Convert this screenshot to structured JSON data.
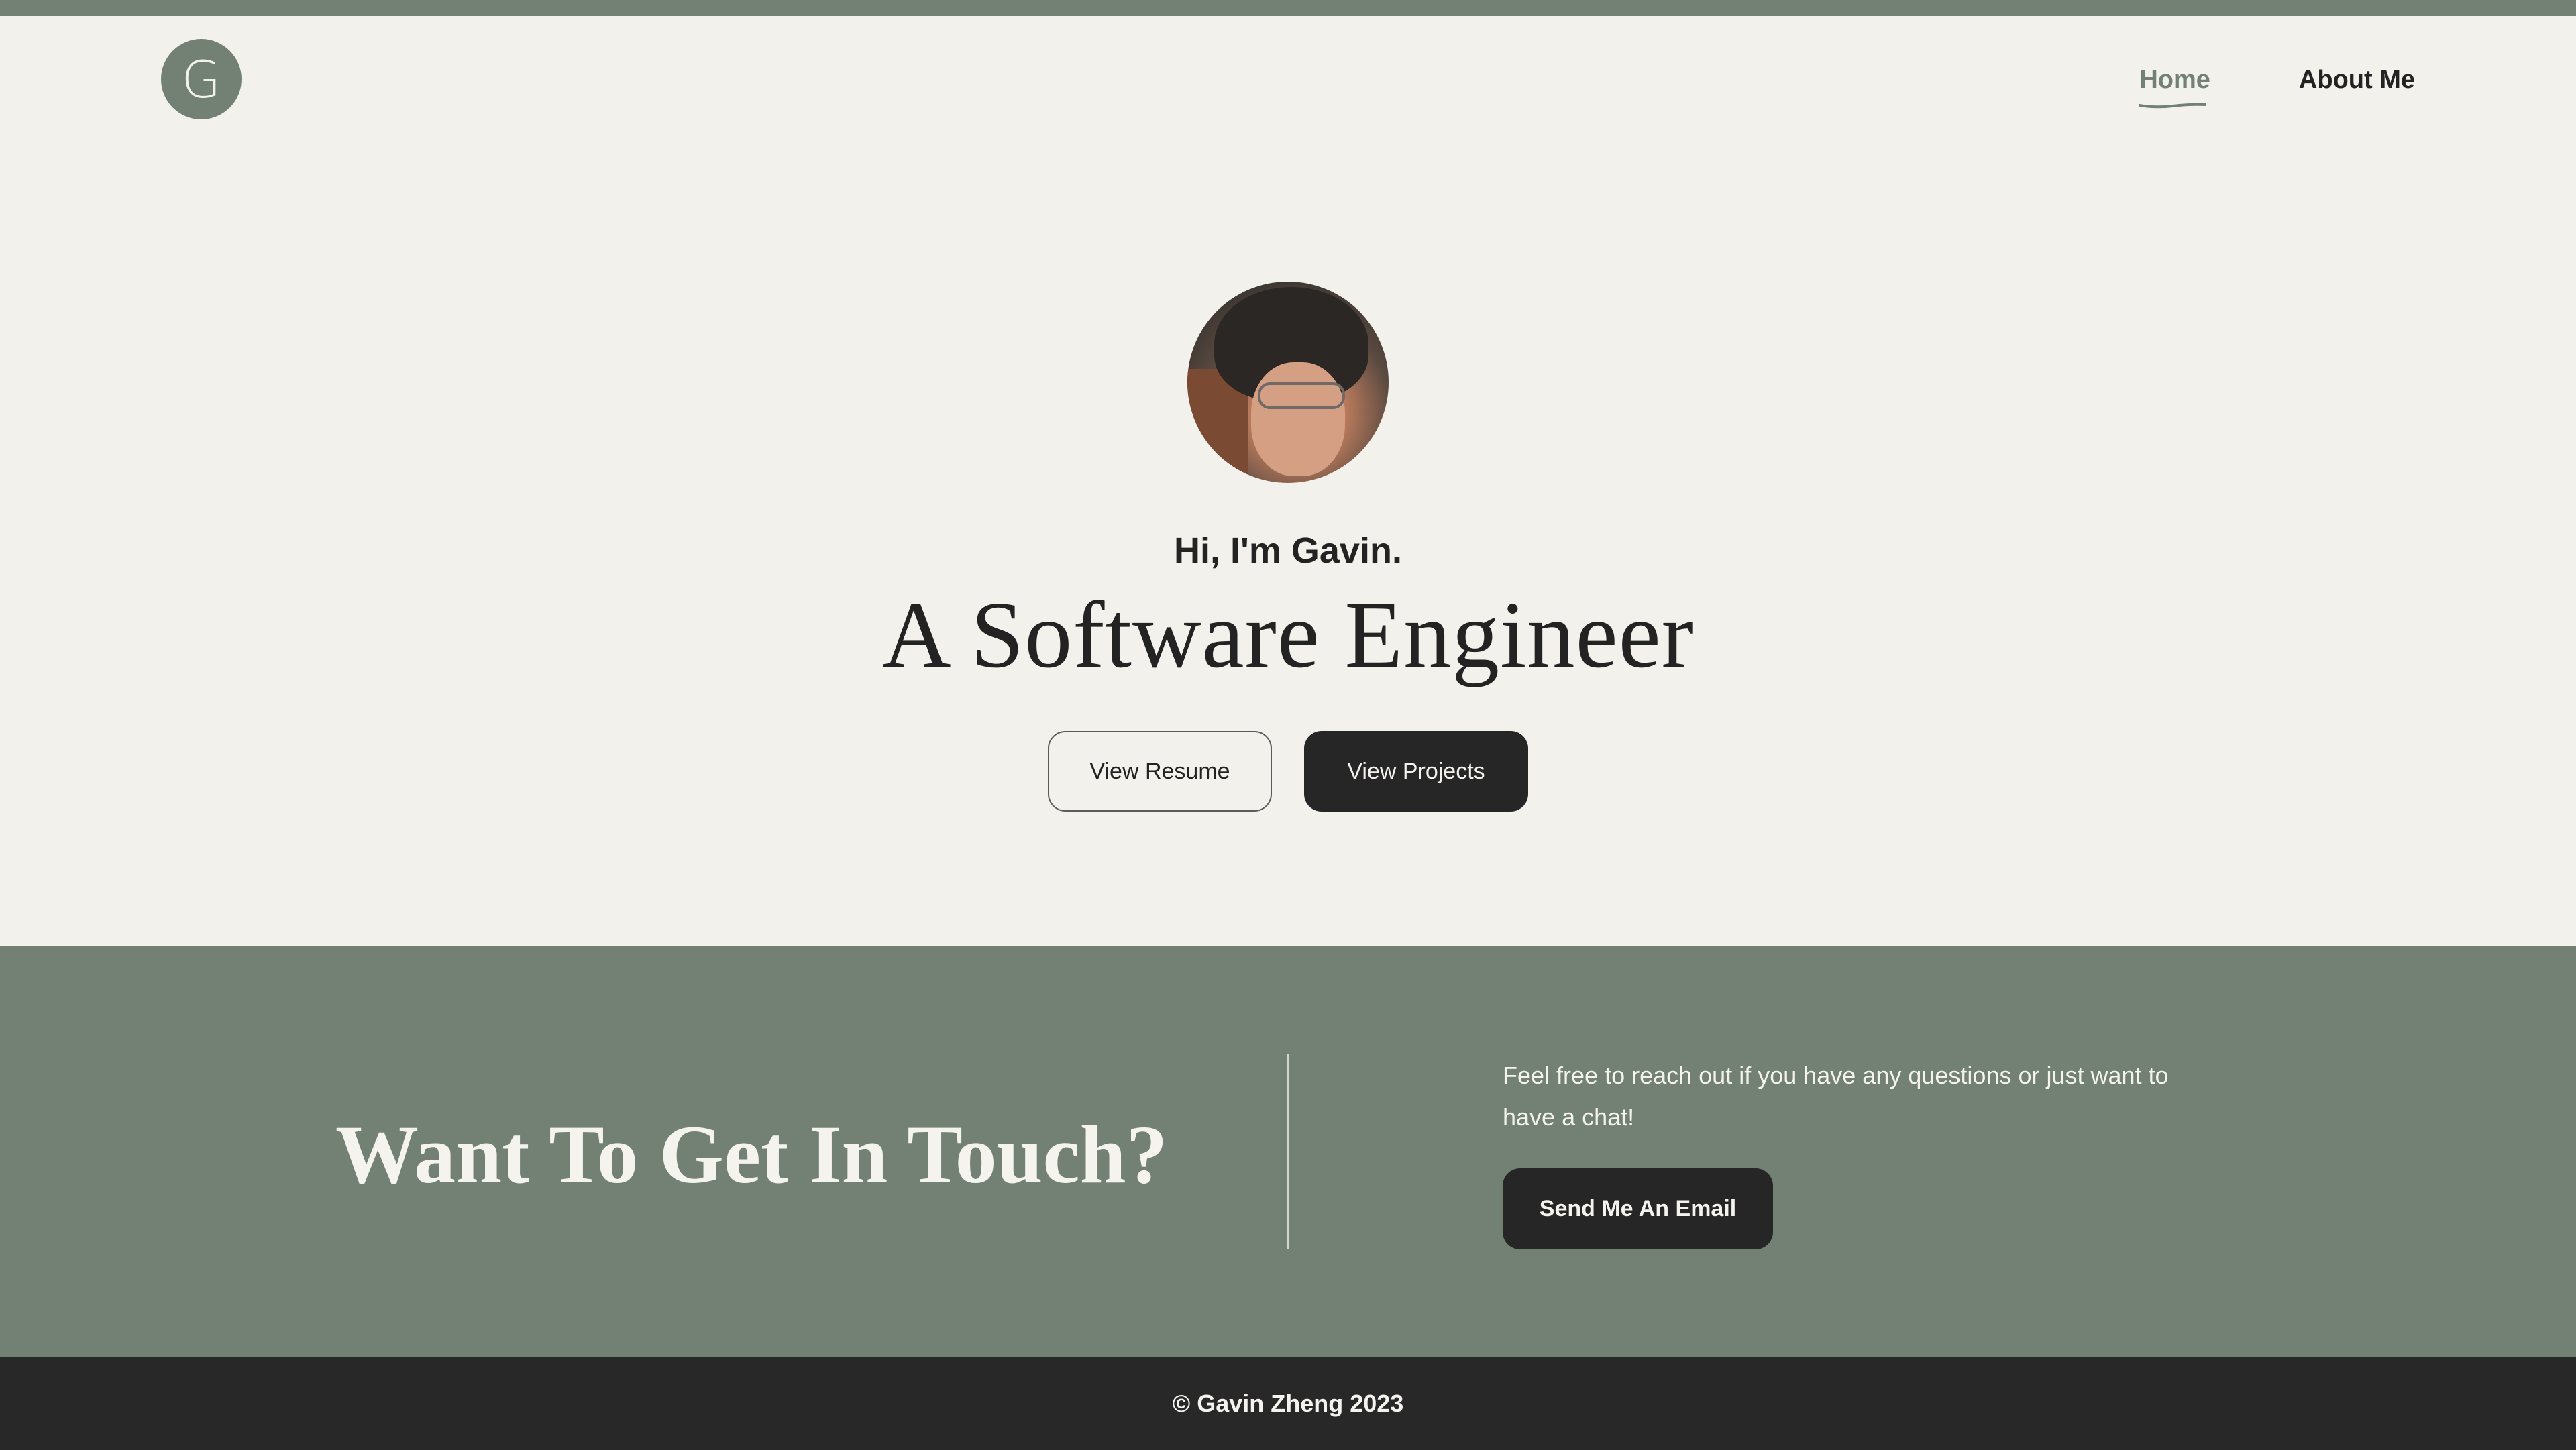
{
  "colors": {
    "accent": "#728174",
    "background": "#f3f1eb",
    "dark": "#262626",
    "footer": "#282828",
    "text": "#232323"
  },
  "header": {
    "logo_letter": "G",
    "nav": [
      {
        "label": "Home",
        "active": true
      },
      {
        "label": "About Me",
        "active": false
      }
    ]
  },
  "hero": {
    "greeting": "Hi, I'm Gavin.",
    "headline": "A Software Engineer",
    "buttons": {
      "resume": "View Resume",
      "projects": "View Projects"
    }
  },
  "contact": {
    "title": "Want To Get In Touch?",
    "text": "Feel free to reach out if you have any questions or just want to have a chat!",
    "button": "Send Me An Email"
  },
  "footer": {
    "copyright": "© Gavin Zheng 2023"
  }
}
